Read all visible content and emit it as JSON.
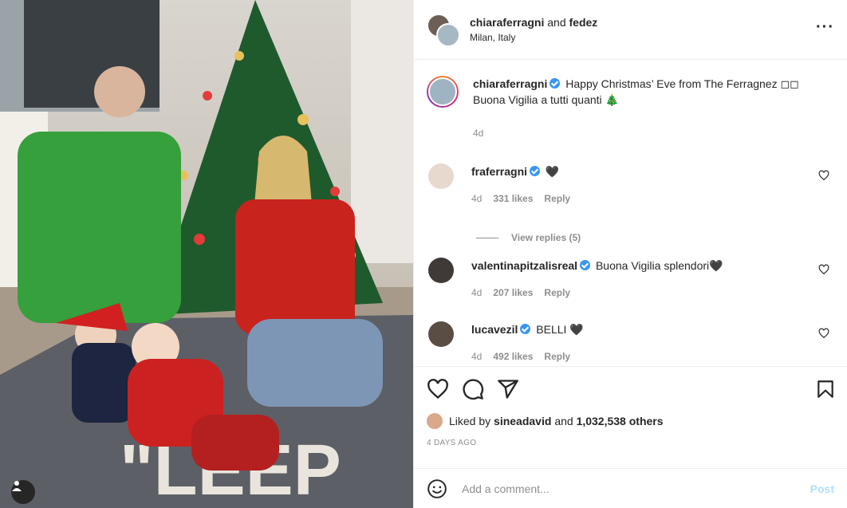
{
  "header": {
    "user1": "chiaraferragni",
    "and_text": "and",
    "user2": "fedez",
    "location": "Milan, Italy",
    "more_icon": "more-horizontal-icon"
  },
  "caption": {
    "username": "chiaraferragni",
    "text_line1": "Happy Christmas’ Eve from The Ferragnez ◻◻",
    "text_line2": "Buona Vigilia a tutti quanti 🎄",
    "time": "4d"
  },
  "comments": [
    {
      "username": "fraferragni",
      "text": "🖤",
      "time": "4d",
      "likes": "331 likes",
      "reply": "Reply"
    },
    {
      "username": "valentinapitzalisreal",
      "text": "Buona Vigilia splendori🖤",
      "time": "4d",
      "likes": "207 likes",
      "reply": "Reply"
    },
    {
      "username": "lucavezil",
      "text": "BELLI 🖤",
      "time": "4d",
      "likes": "492 likes",
      "reply": "Reply"
    }
  ],
  "view_replies": "View replies (5)",
  "likes": {
    "prefix": "Liked by",
    "user": "sineadavid",
    "and_text": "and",
    "count": "1,032,538 others"
  },
  "date": "4 DAYS AGO",
  "add_comment": {
    "placeholder": "Add a comment...",
    "post_label": "Post"
  },
  "colors": {
    "verified": "#3897f0",
    "post_disabled": "#b2dffc",
    "muted": "#8e8e8e"
  }
}
